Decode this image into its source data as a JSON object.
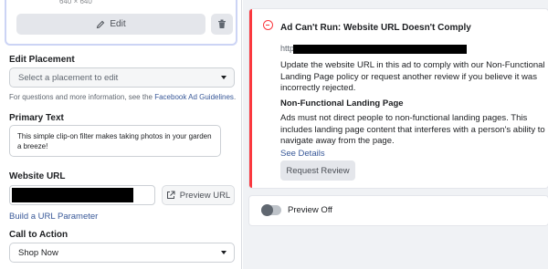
{
  "media": {
    "dimensions": "640 × 640",
    "edit_label": "Edit",
    "edit_icon": "pencil-icon",
    "delete_icon": "trash-icon"
  },
  "placement": {
    "label": "Edit Placement",
    "placeholder": "Select a placement to edit"
  },
  "help": {
    "text": "For questions and more information, see the ",
    "link": "Facebook Ad Guidelines",
    "suffix": "."
  },
  "primary_text": {
    "label": "Primary Text",
    "value": "This simple clip-on filter makes taking photos in your garden a breeze!"
  },
  "website_url": {
    "label": "Website URL",
    "preview_label": "Preview URL",
    "build_link": "Build a URL Parameter"
  },
  "cta": {
    "label": "Call to Action",
    "value": "Shop Now"
  },
  "error": {
    "title": "Ad Can't Run: Website URL Doesn't Comply",
    "url_prefix": "http",
    "body": "Update the website URL in this ad to comply with our Non-Functional Landing Page policy or request another review if you believe it was incorrectly rejected.",
    "subtitle": "Non-Functional Landing Page",
    "description": "Ads must not direct people to non-functional landing pages. This includes landing page content that interferes with a person's ability to navigate away from the page.",
    "see_details": "See Details",
    "request_review": "Request Review",
    "accent_color": "#fa383e"
  },
  "preview": {
    "toggle_label": "Preview Off",
    "toggle_on": false
  },
  "colors": {
    "link": "#385898",
    "button_bg": "#e4e6eb",
    "panel_bg": "#f0f2f5"
  }
}
